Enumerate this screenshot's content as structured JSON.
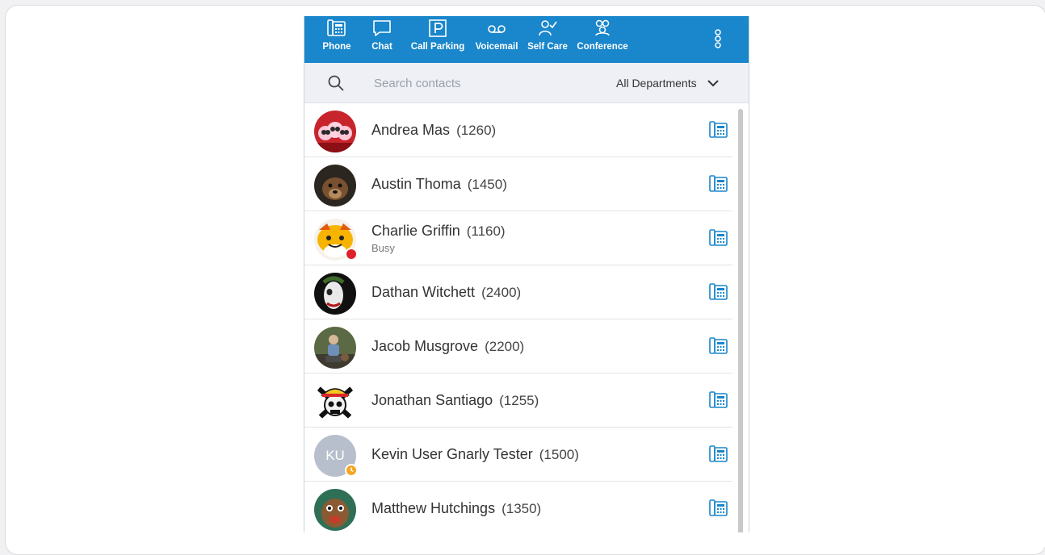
{
  "nav": {
    "items": [
      {
        "label": "Phone",
        "icon": "desk-phone-icon"
      },
      {
        "label": "Chat",
        "icon": "chat-bubble-icon"
      },
      {
        "label": "Call Parking",
        "icon": "parking-icon"
      },
      {
        "label": "Voicemail",
        "icon": "voicemail-icon"
      },
      {
        "label": "Self Care",
        "icon": "user-check-icon"
      },
      {
        "label": "Conference",
        "icon": "group-icon"
      }
    ],
    "more_icon": "vertical-dots-icon"
  },
  "search": {
    "placeholder": "Search contacts",
    "value": "",
    "department": "All Departments"
  },
  "contacts": [
    {
      "name": "Andrea Mas",
      "ext": "(1260)",
      "status": "",
      "initials": ""
    },
    {
      "name": "Austin Thoma",
      "ext": "(1450)",
      "status": "",
      "initials": ""
    },
    {
      "name": "Charlie Griffin",
      "ext": "(1160)",
      "status": "Busy",
      "initials": ""
    },
    {
      "name": "Dathan Witchett",
      "ext": "(2400)",
      "status": "",
      "initials": ""
    },
    {
      "name": "Jacob Musgrove",
      "ext": "(2200)",
      "status": "",
      "initials": ""
    },
    {
      "name": "Jonathan Santiago",
      "ext": "(1255)",
      "status": "",
      "initials": ""
    },
    {
      "name": "Kevin User Gnarly Tester",
      "ext": "(1500)",
      "status": "",
      "initials": "KU"
    },
    {
      "name": "Matthew Hutchings",
      "ext": "(1350)",
      "status": "",
      "initials": ""
    }
  ],
  "colors": {
    "header": "#1a86cb",
    "busy": "#e0202a",
    "away": "#f5a623",
    "icon_blue": "#1a86cb"
  }
}
